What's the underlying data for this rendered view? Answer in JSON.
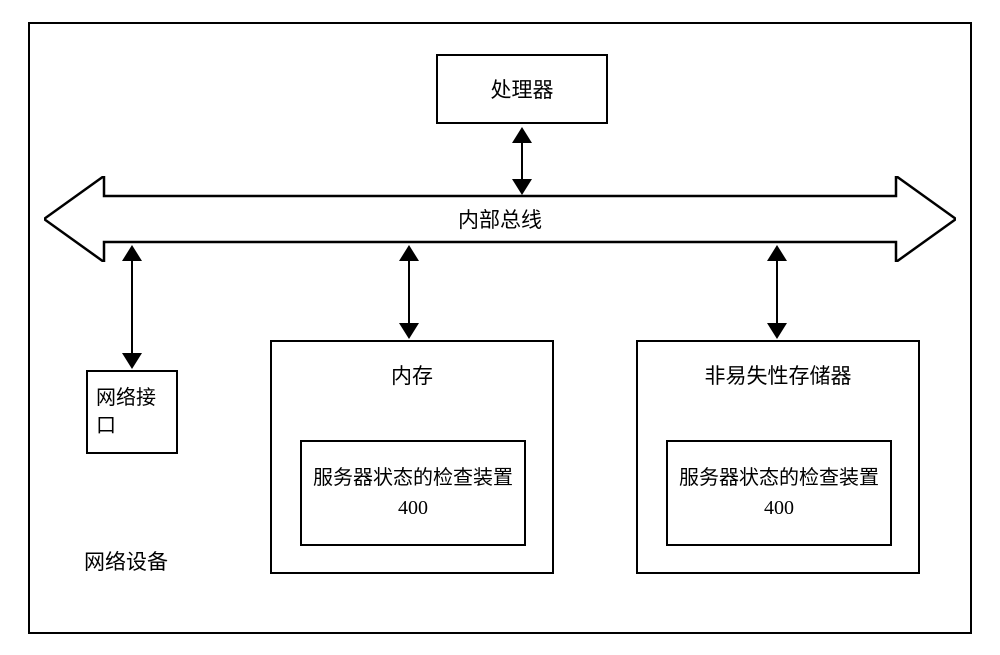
{
  "diagram": {
    "processor": "处理器",
    "bus": "内部总线",
    "network_interface": "网络接口",
    "memory": "内存",
    "nv_storage": "非易失性存储器",
    "checker_device_name": "服务器状态的检查装置",
    "checker_device_num": "400",
    "device_label": "网络设备"
  }
}
